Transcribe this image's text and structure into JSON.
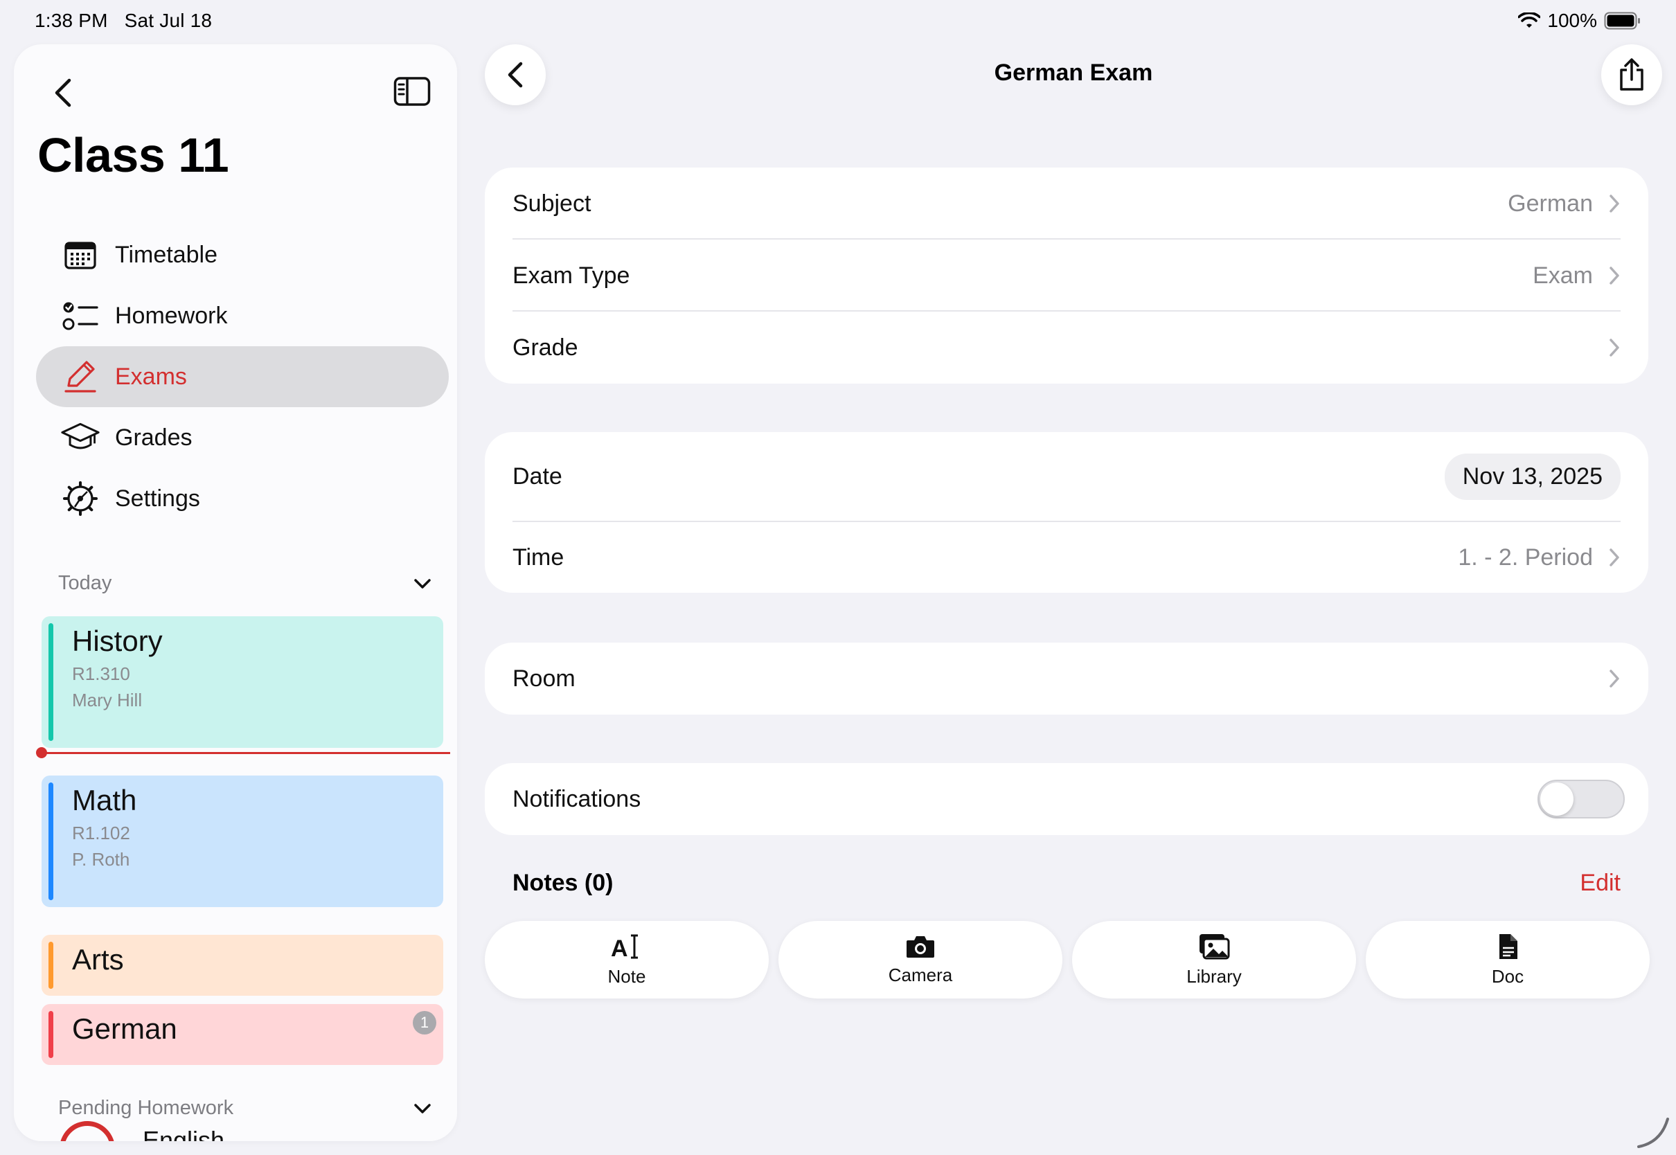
{
  "status_bar": {
    "time": "1:38 PM",
    "date": "Sat Jul 18",
    "battery": "100%",
    "icons": [
      "wifi-icon",
      "battery-icon"
    ]
  },
  "sidebar": {
    "title": "Class 11",
    "nav": [
      {
        "label": "Timetable",
        "icon": "calendar-icon",
        "active": false
      },
      {
        "label": "Homework",
        "icon": "checklist-icon",
        "active": false
      },
      {
        "label": "Exams",
        "icon": "pencil-icon",
        "active": true
      },
      {
        "label": "Grades",
        "icon": "graduation-cap-icon",
        "active": false
      },
      {
        "label": "Settings",
        "icon": "gear-icon",
        "active": false
      }
    ],
    "today": {
      "header": "Today",
      "lessons": [
        {
          "name": "History",
          "room": "R1.310",
          "teacher": "Mary Hill",
          "color": "#14c7ab",
          "bg": "#c9f3ee"
        },
        {
          "name": "Math",
          "room": "R1.102",
          "teacher": "P. Roth",
          "color": "#1e88ff",
          "bg": "#cae4fd"
        },
        {
          "name": "Arts",
          "color": "#ff9a2e",
          "bg": "#ffe6d3"
        },
        {
          "name": "German",
          "color": "#f0404a",
          "bg": "#ffd6d8",
          "badge": "1"
        }
      ]
    },
    "pending": {
      "header": "Pending Homework",
      "first_item": "English"
    }
  },
  "detail": {
    "title": "German Exam",
    "group1": [
      {
        "key": "Subject",
        "value": "German"
      },
      {
        "key": "Exam Type",
        "value": "Exam"
      },
      {
        "key": "Grade",
        "value": ""
      }
    ],
    "group2": {
      "date_label": "Date",
      "date_value": "Nov 13, 2025",
      "time_label": "Time",
      "time_value": "1. - 2. Period"
    },
    "room": {
      "key": "Room",
      "value": ""
    },
    "notifications": {
      "label": "Notifications",
      "enabled": false
    },
    "notes": {
      "title": "Notes (0)",
      "edit": "Edit",
      "attachments": [
        {
          "label": "Note",
          "icon": "text-cursor-icon"
        },
        {
          "label": "Camera",
          "icon": "camera-icon"
        },
        {
          "label": "Library",
          "icon": "photo-library-icon"
        },
        {
          "label": "Doc",
          "icon": "document-icon"
        }
      ]
    }
  },
  "colors": {
    "accent": "#d32f2f",
    "background": "#f2f2f7"
  }
}
